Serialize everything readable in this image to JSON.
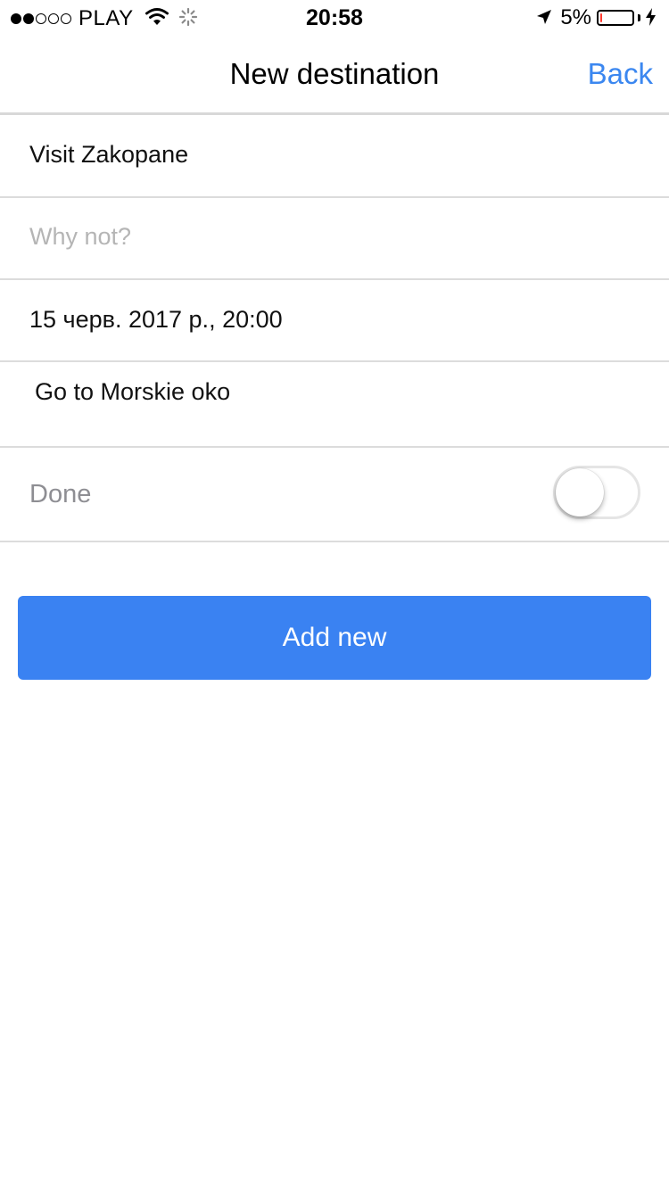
{
  "status_bar": {
    "signal_filled": 2,
    "signal_total": 5,
    "carrier": "PLAY",
    "time": "20:58",
    "battery_percent": "5%",
    "battery_level": 0.05,
    "icons": [
      "wifi-icon",
      "activity-spinner-icon",
      "location-arrow-icon",
      "charging-bolt-icon"
    ]
  },
  "nav": {
    "title": "New destination",
    "back_label": "Back"
  },
  "form": {
    "title_value": "Visit Zakopane",
    "reason_placeholder": "Why not?",
    "date_value": "15 черв. 2017 р., 20:00",
    "description_value": "Go to Morskie oko",
    "done_label": "Done",
    "done_on": false
  },
  "actions": {
    "add_label": "Add new"
  },
  "colors": {
    "accent": "#3a82f2",
    "link": "#3b87f0",
    "separator": "#dcdcdc",
    "placeholder": "#b5b5b5",
    "battery_low": "#ff3b30"
  }
}
